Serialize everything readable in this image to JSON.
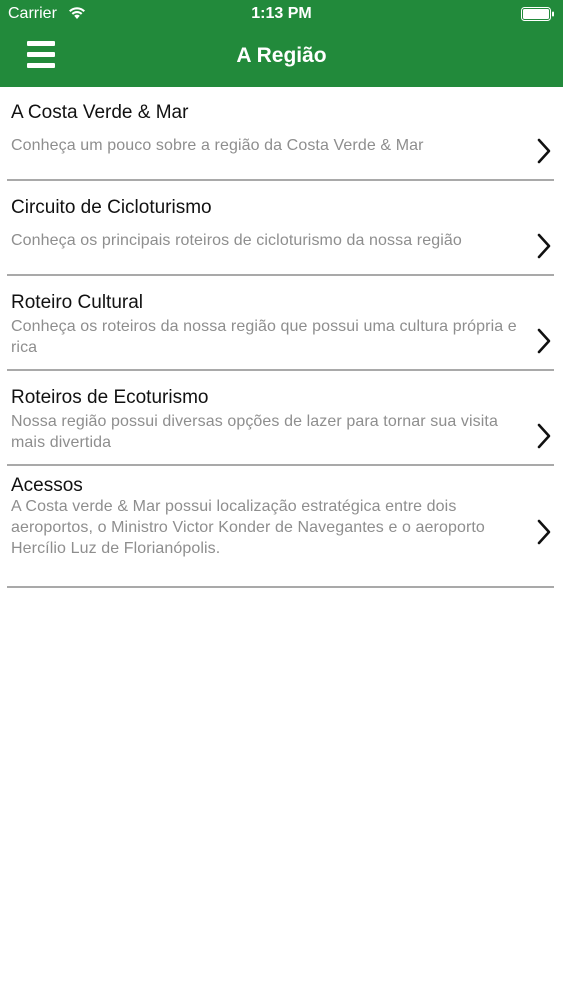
{
  "status_bar": {
    "carrier": "Carrier",
    "time": "1:13 PM",
    "wifi_icon": "wifi-icon",
    "battery_icon": "battery-icon"
  },
  "nav": {
    "title": "A Região",
    "menu_icon": "hamburger-menu-icon",
    "background_color": "#228a3b"
  },
  "items": [
    {
      "title": "A Costa Verde & Mar",
      "subtitle": "Conheça um pouco sobre a região da Costa Verde & Mar"
    },
    {
      "title": "Circuito de Cicloturismo",
      "subtitle": "Conheça os principais roteiros de cicloturismo da nossa região"
    },
    {
      "title": "Roteiro Cultural",
      "subtitle": "Conheça os roteiros da nossa região que possui uma cultura própria e rica"
    },
    {
      "title": "Roteiros de Ecoturismo",
      "subtitle": "Nossa região possui diversas opções de lazer para tornar sua visita mais divertida"
    },
    {
      "title": "Acessos",
      "subtitle": "A Costa verde & Mar possui localização estratégica entre dois aeroportos, o Ministro Victor Konder de Navegantes e o aeroporto Hercílio Luz de Florianópolis."
    }
  ]
}
